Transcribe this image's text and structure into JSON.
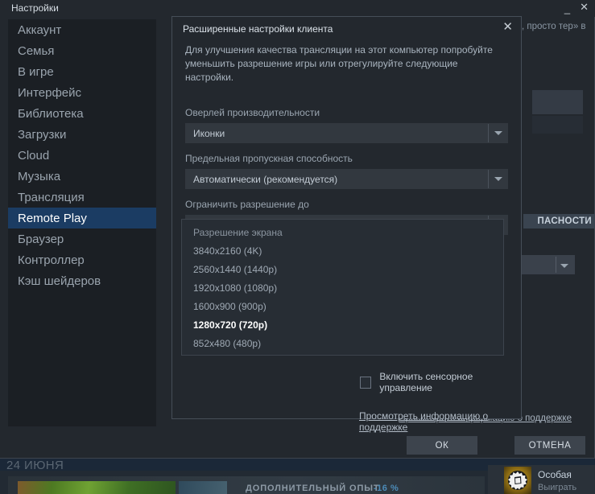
{
  "window": {
    "title": "Настройки",
    "minimize_label": "_",
    "close_label": "✕"
  },
  "sidebar": {
    "items": [
      {
        "label": "Аккаунт",
        "selected": false
      },
      {
        "label": "Семья",
        "selected": false
      },
      {
        "label": "В игре",
        "selected": false
      },
      {
        "label": "Интерфейс",
        "selected": false
      },
      {
        "label": "Библиотека",
        "selected": false
      },
      {
        "label": "Загрузки",
        "selected": false
      },
      {
        "label": "Cloud",
        "selected": false
      },
      {
        "label": "Музыка",
        "selected": false
      },
      {
        "label": "Трансляция",
        "selected": false
      },
      {
        "label": "Remote Play",
        "selected": true
      },
      {
        "label": "Браузер",
        "selected": false
      },
      {
        "label": "Контроллер",
        "selected": false
      },
      {
        "label": "Кэш шейдеров",
        "selected": false
      }
    ]
  },
  "background_panel": {
    "top_right_text": ", просто\nтер» в",
    "security_tab_label": "ПАСНОСТИ",
    "support_link": "Просмотреть информацию о поддержке",
    "ok_label": "ОК",
    "cancel_label": "ОТМЕНА"
  },
  "modal": {
    "title": "Расширенные настройки клиента",
    "close_label": "✕",
    "description": "Для улучшения качества трансляции на этот компьютер попробуйте уменьшить разрешение игры или отрегулируйте следующие настройки.",
    "fields": [
      {
        "label": "Оверлей производительности",
        "value": "Иконки"
      },
      {
        "label": "Предельная пропускная способность",
        "value": "Автоматически (рекомендуется)"
      },
      {
        "label": "Ограничить разрешение до",
        "value": "Разрешение экрана"
      }
    ],
    "dropdown_options": [
      {
        "label": "Разрешение экрана",
        "selected": false
      },
      {
        "label": "3840x2160 (4K)",
        "selected": false
      },
      {
        "label": "2560x1440 (1440p)",
        "selected": false
      },
      {
        "label": "1920x1080 (1080p)",
        "selected": false
      },
      {
        "label": "1600x900 (900p)",
        "selected": false
      },
      {
        "label": "1280x720 (720p)",
        "selected": true
      },
      {
        "label": "852x480 (480p)",
        "selected": false
      }
    ],
    "checkbox_label": "Включить сенсорное управление",
    "checkbox_checked": false,
    "support_link": "Просмотреть информацию о поддержке",
    "ok_label": "OK"
  },
  "store": {
    "date": "24 ИЮНЯ",
    "capsule_label": "ДОПОЛНИТЕЛЬНЫЙ ОПЫТ",
    "capsule_price": "-16 %",
    "badge_title": "Особая",
    "badge_subtitle": "Выиграть"
  },
  "colors": {
    "accent_selected": "#1b3c63",
    "window_bg": "#23282e",
    "sidebar_bg": "#1b1f24",
    "text_primary": "#c3ccd5",
    "text_muted": "#9aa5b0",
    "link": "#b3bdc8"
  }
}
